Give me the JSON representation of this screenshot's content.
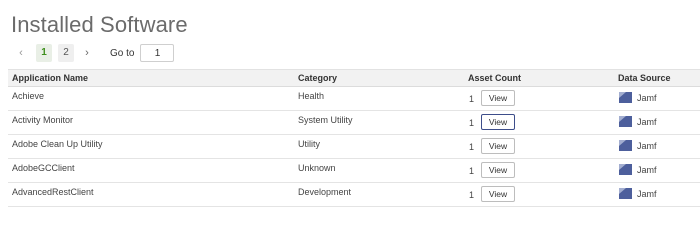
{
  "page": {
    "title": "Installed Software"
  },
  "pager": {
    "prev_icon": "chevron-left-icon",
    "pages": [
      "1",
      "2"
    ],
    "active_page": "1",
    "next_icon": "chevron-right-icon",
    "goto_label": "Go to",
    "goto_value": "1"
  },
  "table": {
    "headers": {
      "name": "Application Name",
      "category": "Category",
      "asset_count": "Asset Count",
      "data_source": "Data Source"
    },
    "rows": [
      {
        "name": "Achieve",
        "category": "Health",
        "count": "1",
        "view_label": "View",
        "source": "Jamf"
      },
      {
        "name": "Activity Monitor",
        "category": "System Utility",
        "count": "1",
        "view_label": "View",
        "source": "Jamf"
      },
      {
        "name": "Adobe Clean Up Utility",
        "category": "Utility",
        "count": "1",
        "view_label": "View",
        "source": "Jamf"
      },
      {
        "name": "AdobeGCClient",
        "category": "Unknown",
        "count": "1",
        "view_label": "View",
        "source": "Jamf"
      },
      {
        "name": "AdvancedRestClient",
        "category": "Development",
        "count": "1",
        "view_label": "View",
        "source": "Jamf"
      }
    ]
  },
  "colors": {
    "active_page": "#3f8f1e",
    "focused_button_border": "#3d4d8a",
    "jamf_icon": "#4d5f9c"
  }
}
